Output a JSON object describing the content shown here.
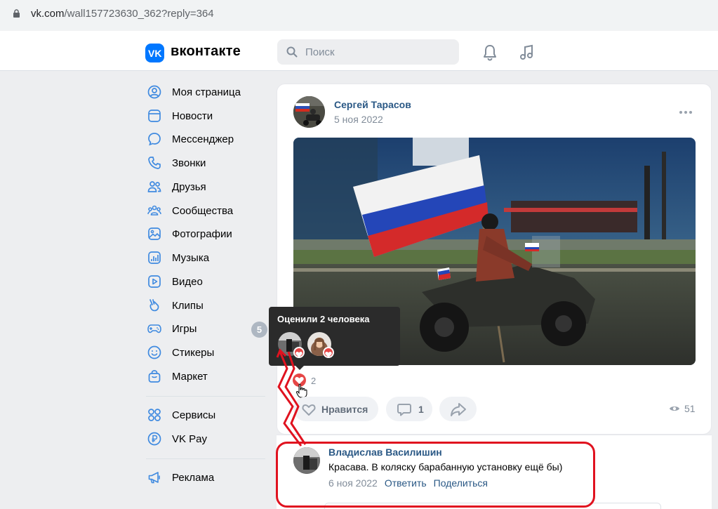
{
  "browser": {
    "url_host": "vk.com",
    "url_path": "/wall157723630_362?reply=364"
  },
  "header": {
    "logo_text": "вконтакте",
    "search_placeholder": "Поиск"
  },
  "sidebar": {
    "items": [
      {
        "label": "Моя страница",
        "icon": "user-circle-icon"
      },
      {
        "label": "Новости",
        "icon": "news-icon"
      },
      {
        "label": "Мессенджер",
        "icon": "chat-bubble-icon"
      },
      {
        "label": "Звонки",
        "icon": "phone-icon"
      },
      {
        "label": "Друзья",
        "icon": "friends-icon"
      },
      {
        "label": "Сообщества",
        "icon": "communities-icon"
      },
      {
        "label": "Фотографии",
        "icon": "photo-icon"
      },
      {
        "label": "Музыка",
        "icon": "music-icon"
      },
      {
        "label": "Видео",
        "icon": "video-icon"
      },
      {
        "label": "Клипы",
        "icon": "clips-icon"
      },
      {
        "label": "Игры",
        "icon": "gamepad-icon",
        "badge": "5"
      },
      {
        "label": "Стикеры",
        "icon": "smile-icon"
      },
      {
        "label": "Маркет",
        "icon": "shopping-bag-icon"
      },
      {
        "label": "Сервисы",
        "icon": "services-icon"
      },
      {
        "label": "VK Pay",
        "icon": "rouble-icon"
      },
      {
        "label": "Реклама",
        "icon": "megaphone-icon"
      }
    ]
  },
  "post": {
    "author": "Сергей Тарасов",
    "date": "5 ноя 2022",
    "likes_tooltip": "Оценили 2 человека",
    "likes_count": "2",
    "like_label": "Нравится",
    "comments_count": "1",
    "views": "51"
  },
  "comment": {
    "author": "Владислав Василишин",
    "text": "Красава. В коляску барабанную установку ещё бы)",
    "date": "6 ноя 2022",
    "reply_label": "Ответить",
    "share_label": "Поделиться"
  },
  "colors": {
    "accent": "#0077ff",
    "link": "#2a5885",
    "like": "#e64646",
    "annotation": "#e0121f"
  }
}
